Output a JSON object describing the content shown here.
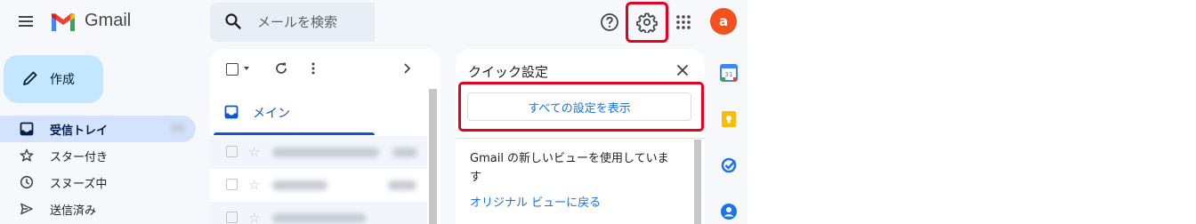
{
  "header": {
    "app_name": "Gmail",
    "search_placeholder": "メールを検索",
    "avatar_letter": "a"
  },
  "nav": {
    "compose_label": "作成",
    "items": [
      {
        "label": "受信トレイ",
        "icon": "inbox-icon",
        "active": true
      },
      {
        "label": "スター付き",
        "icon": "star-icon",
        "active": false
      },
      {
        "label": "スヌーズ中",
        "icon": "clock-icon",
        "active": false
      },
      {
        "label": "送信済み",
        "icon": "send-icon",
        "active": false
      }
    ]
  },
  "mail_list": {
    "tab_label": "メイン"
  },
  "quick_settings": {
    "title": "クイック設定",
    "see_all_button": "すべての設定を表示",
    "view_text": "Gmail の新しいビューを使用していま す",
    "revert_link": "オリジナル ビューに戻る"
  },
  "colors": {
    "accent": "#0b57d0",
    "highlight": "#e6001f",
    "avatar": "#f4511e"
  }
}
